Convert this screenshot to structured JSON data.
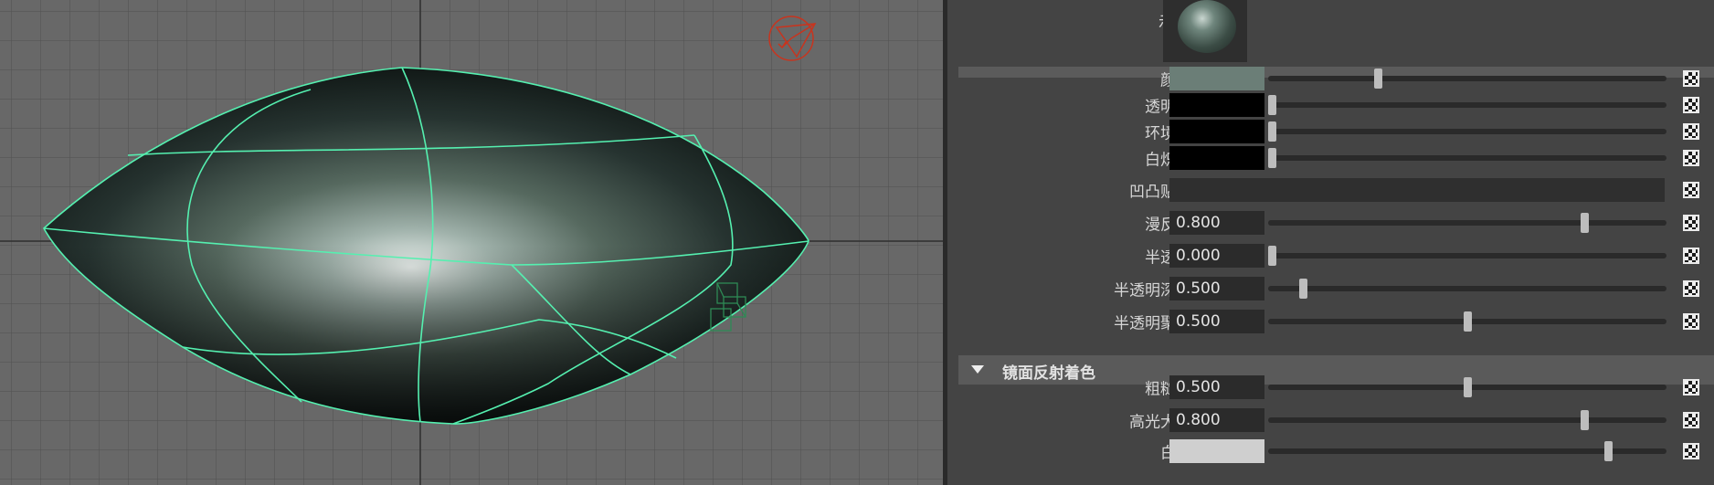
{
  "attribute_editor": {
    "sample_label": "示例",
    "rows_top": [
      {
        "name": "color",
        "label": "颜色",
        "kind": "color",
        "color": "#6b7e77",
        "slider": 0.27
      },
      {
        "name": "transparency",
        "label": "透明度",
        "kind": "color",
        "color": "#000000",
        "slider": 0.0
      },
      {
        "name": "ambient-color",
        "label": "环境色",
        "kind": "color",
        "color": "#000000",
        "slider": 0.0
      },
      {
        "name": "incandescence",
        "label": "白炽度",
        "kind": "color",
        "color": "#000000",
        "slider": 0.0
      },
      {
        "name": "bump-map",
        "label": "凹凸贴图",
        "kind": "map"
      },
      {
        "name": "diffuse",
        "label": "漫反射",
        "kind": "number",
        "value": "0.800",
        "slider": 0.8
      },
      {
        "name": "translucence",
        "label": "半透明",
        "kind": "number",
        "value": "0.000",
        "slider": 0.0
      },
      {
        "name": "translucence-depth",
        "label": "半透明深度",
        "kind": "number",
        "value": "0.500",
        "slider": 0.08
      },
      {
        "name": "translucence-focus",
        "label": "半透明聚焦",
        "kind": "number",
        "value": "0.500",
        "slider": 0.5
      }
    ],
    "specular_section": {
      "title": "镜面反射着色",
      "rows": [
        {
          "name": "roughness",
          "label": "粗糙度",
          "kind": "number",
          "value": "0.500",
          "slider": 0.5
        },
        {
          "name": "highlight-size",
          "label": "高光大小",
          "kind": "number",
          "value": "0.800",
          "slider": 0.8
        },
        {
          "name": "whiteness",
          "label": "白度",
          "kind": "color",
          "color": "#cfcfcf",
          "slider": 0.86
        }
      ]
    }
  },
  "viewport": {
    "mesh_wire_color": "#55f0b0",
    "light_icon_color": "#c8341e",
    "object_label": "polygon-mesh"
  }
}
